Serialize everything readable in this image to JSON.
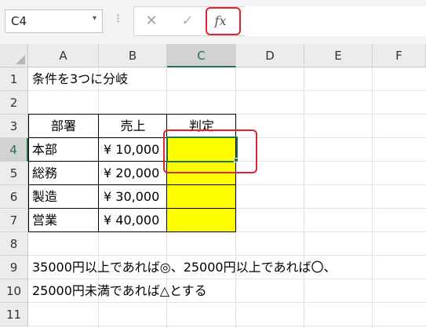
{
  "formula_bar": {
    "name_box": "C4",
    "name_box_arrow": "▾",
    "grip": "⁝",
    "cancel_symbol": "✕",
    "enter_symbol": "✓",
    "fx_symbol": "fx",
    "formula": ""
  },
  "columns": [
    "A",
    "B",
    "C",
    "D",
    "E",
    "F"
  ],
  "selected_column": "C",
  "rows": [
    "1",
    "2",
    "3",
    "4",
    "5",
    "6",
    "7",
    "8",
    "9",
    "10",
    "11"
  ],
  "selected_row": "4",
  "cells": {
    "A1": "条件を3つに分岐",
    "A3": "部署",
    "B3": "売上",
    "C3": "判定",
    "A4": "本部",
    "B4": "¥ 10,000",
    "A5": "総務",
    "B5": "¥ 20,000",
    "A6": "製造",
    "B6": "¥ 30,000",
    "A7": "営業",
    "B7": "¥ 40,000",
    "A9": "35000円以上であれば◎、25000円以上であれば〇、",
    "A10": "25000円未満であれば△とする"
  },
  "colors": {
    "judgement_fill": "#ffff00",
    "selection_accent": "#217346",
    "callout_red": "#e0242c"
  },
  "icons": [
    "dropdown-arrow-icon",
    "cancel-icon",
    "enter-check-icon",
    "insert-function-icon",
    "select-all-icon"
  ]
}
